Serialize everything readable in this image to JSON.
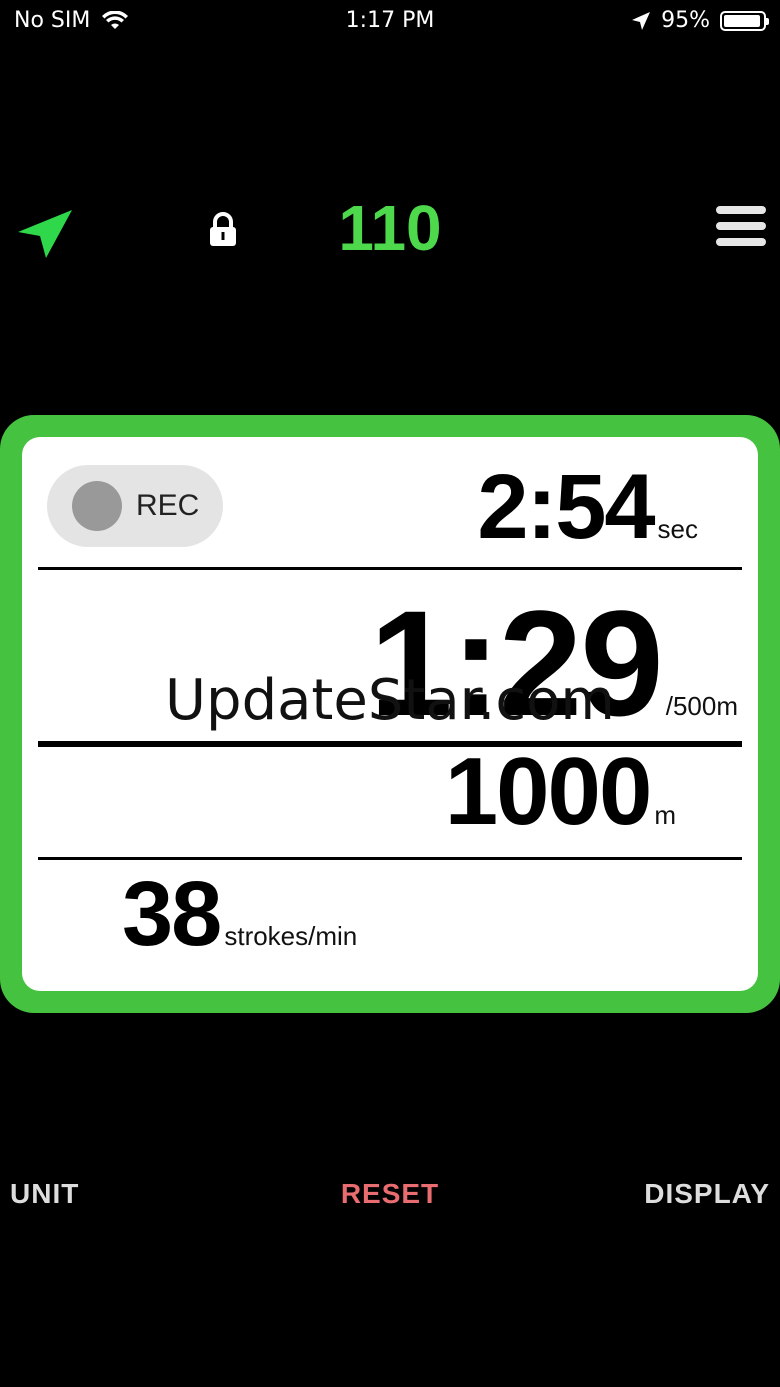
{
  "status_bar": {
    "carrier": "No SIM",
    "time": "1:17 PM",
    "battery": "95%",
    "battery_level": 0.95
  },
  "top_bar": {
    "counter": "110",
    "icons": [
      "navigation-arrow-icon",
      "lock-icon",
      "hamburger-menu-icon"
    ],
    "accent_color": "#4ed94c"
  },
  "panel": {
    "rec_label": "REC",
    "time": {
      "value": "2:54",
      "unit": "sec"
    },
    "split": {
      "value": "1:29",
      "unit": "/500m"
    },
    "distance": {
      "value": "1000",
      "unit": "m"
    },
    "stroke_rate": {
      "value": "38",
      "unit": "strokes/min"
    },
    "border_color": "#45c23f"
  },
  "watermark": "UpdateStar.com",
  "bottom_bar": {
    "unit_label": "UNIT",
    "reset_label": "RESET",
    "display_label": "DISPLAY",
    "reset_color": "#e86c70"
  }
}
